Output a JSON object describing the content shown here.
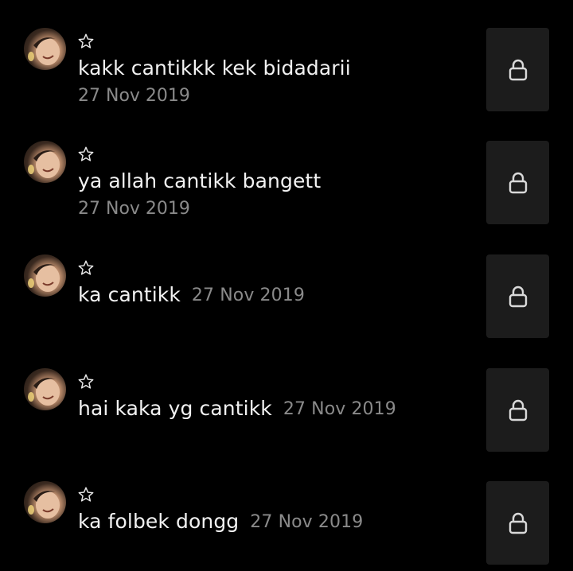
{
  "comments": [
    {
      "text": "kakk cantikkk kek bidadarii",
      "date": "27 Nov 2019",
      "date_inline": false
    },
    {
      "text": "ya allah cantikk bangett",
      "date": "27 Nov 2019",
      "date_inline": false
    },
    {
      "text": "ka cantikk",
      "date": "27 Nov 2019",
      "date_inline": true
    },
    {
      "text": "hai kaka yg cantikk",
      "date": "27 Nov 2019",
      "date_inline": true
    },
    {
      "text": "ka folbek dongg",
      "date": "27 Nov 2019",
      "date_inline": true
    }
  ],
  "icons": {
    "star": "star-outline-icon",
    "lock": "lock-icon"
  },
  "colors": {
    "background": "#000000",
    "text": "#f2f2f2",
    "date": "#8a8a8a",
    "button": "#1c1c1c",
    "icon": "#d9d9d9"
  }
}
